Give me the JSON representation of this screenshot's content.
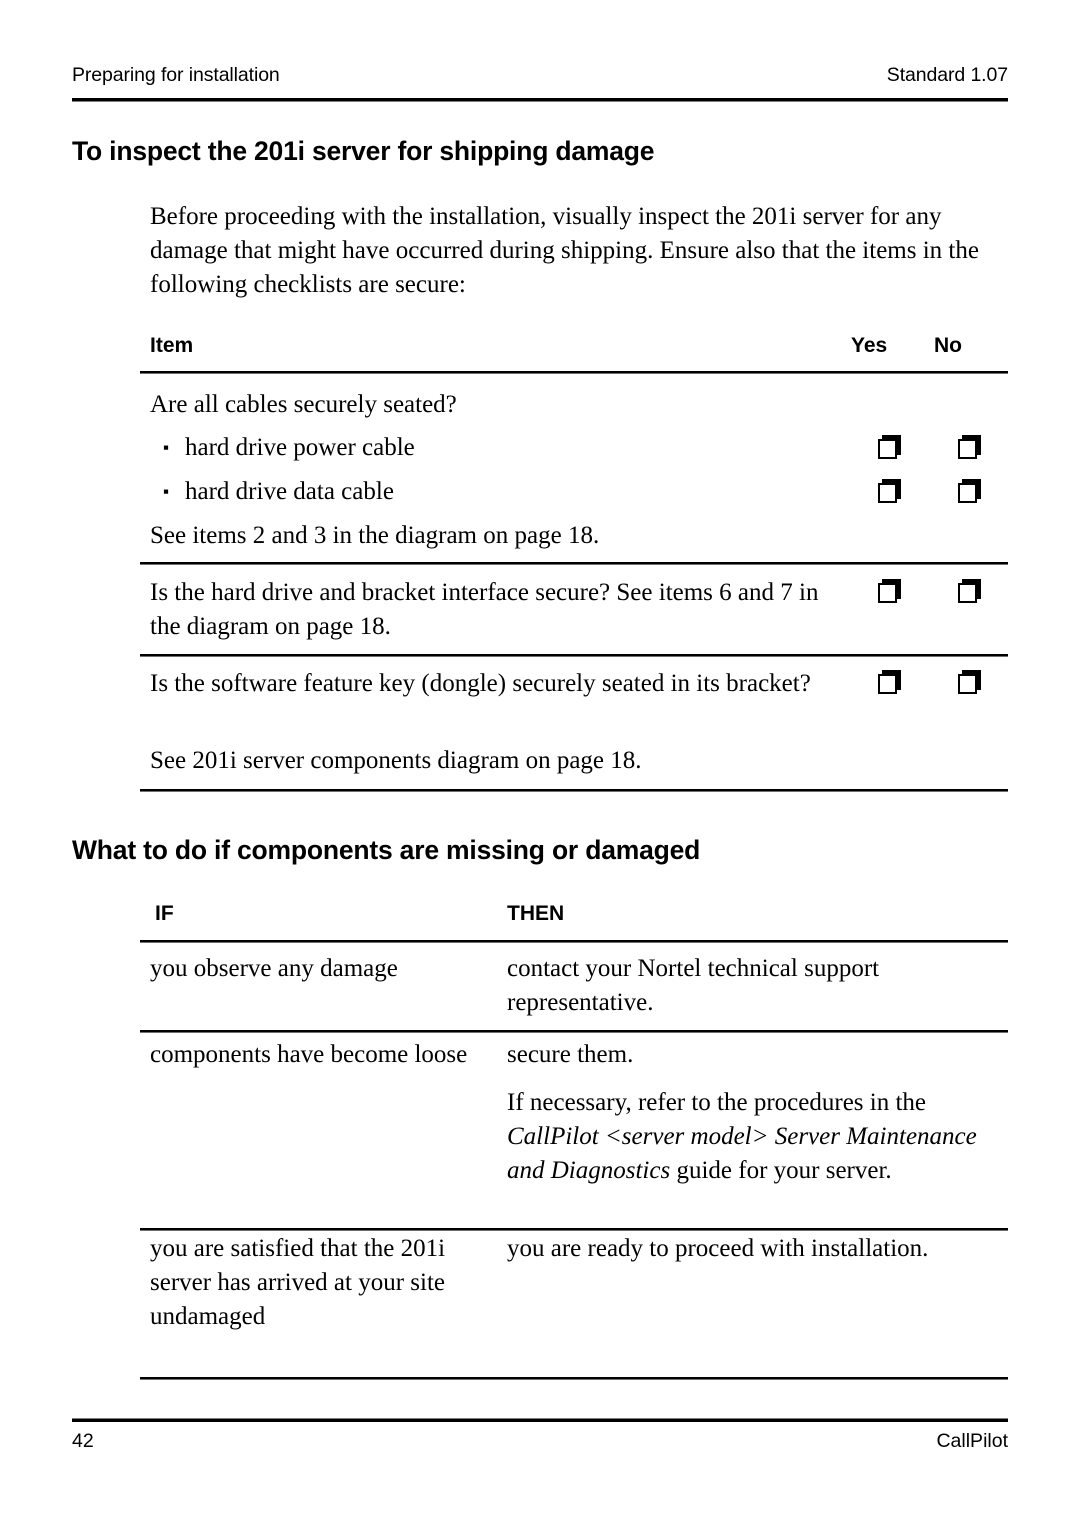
{
  "header": {
    "left": "Preparing for installation",
    "right": "Standard 1.07"
  },
  "section1": {
    "heading": "To inspect the 201i server for shipping damage",
    "intro": "Before proceeding with the installation, visually inspect the 201i server for any damage that might have occurred during shipping. Ensure also that the items in the following checklists are secure:",
    "table": {
      "columns": [
        "Item",
        "Yes",
        "No"
      ],
      "rows": [
        {
          "text": "Are all cables securely seated?",
          "bullets": [
            "hard drive power cable",
            "hard drive data cable"
          ],
          "note": "See items 2 and 3 in the diagram on page 18.",
          "bullet_glyph": "▪",
          "yes_checkbox": "unchecked",
          "no_checkbox": "unchecked"
        },
        {
          "text": "Is the hard drive and bracket interface secure? See items 6 and 7 in the diagram on page 18.",
          "bullets": [],
          "note": "",
          "yes_checkbox": "unchecked",
          "no_checkbox": "unchecked"
        },
        {
          "text": "Is the software feature key (dongle) securely seated in its bracket?",
          "bullets": [],
          "note": "See 201i server components diagram on page 18.",
          "yes_checkbox": "unchecked",
          "no_checkbox": "unchecked"
        }
      ]
    }
  },
  "section2": {
    "heading": "What to do if components are missing or damaged",
    "table": {
      "columns": [
        "IF",
        "THEN"
      ],
      "rows": [
        {
          "if": "you observe any damage",
          "then_paras": [
            {
              "text": "contact your Nortel technical support representative.",
              "italic": ""
            }
          ]
        },
        {
          "if": "components have become loose",
          "then_paras": [
            {
              "text": "secure them.",
              "italic": ""
            },
            {
              "lead": "If necessary, refer to the procedures in the ",
              "italic": "CallPilot <server model> Server Maintenance and Diagnostics",
              "tail": " guide for your server."
            }
          ]
        },
        {
          "if": "you are satisfied that the 201i server has arrived at your site undamaged",
          "then_paras": [
            {
              "text": "you are ready to proceed with installation.",
              "italic": ""
            }
          ]
        }
      ]
    }
  },
  "footer": {
    "page_number": "42",
    "product": "CallPilot"
  }
}
